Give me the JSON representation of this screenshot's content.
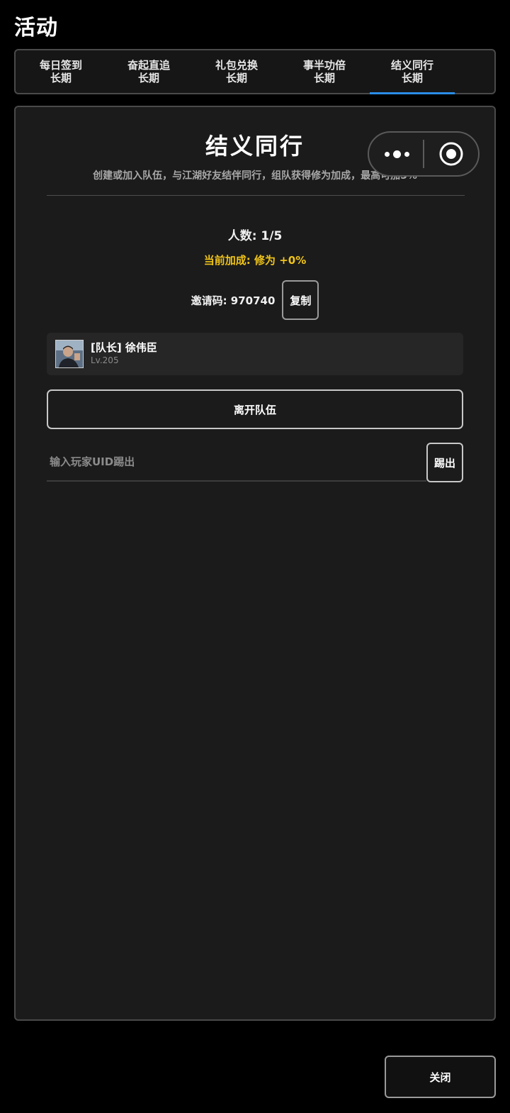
{
  "page": {
    "title": "活动"
  },
  "tabs": [
    {
      "label": "每日签到",
      "sub": "长期"
    },
    {
      "label": "奋起直追",
      "sub": "长期"
    },
    {
      "label": "礼包兑换",
      "sub": "长期"
    },
    {
      "label": "事半功倍",
      "sub": "长期"
    },
    {
      "label": "结义同行",
      "sub": "长期",
      "active": true
    }
  ],
  "panel": {
    "title": "结义同行",
    "description": "创建或加入队伍，与江湖好友结伴同行，组队获得修为加成，最高可加5%",
    "members_count": "人数: 1/5",
    "bonus": "当前加成: 修为 +0%",
    "invite_code": "邀请码: 970740",
    "copy_label": "复制",
    "member": {
      "name": "[队长] 徐伟臣",
      "level": "Lv.205"
    },
    "leave_label": "离开队伍",
    "kick_placeholder": "输入玩家UID踢出",
    "kick_label": "踢出"
  },
  "footer": {
    "close_label": "关闭"
  },
  "colors": {
    "accent": "#2a8ce8",
    "bonus": "#f0c419"
  },
  "icons": {
    "menu": "more-icon",
    "capsule_close": "target-icon"
  }
}
